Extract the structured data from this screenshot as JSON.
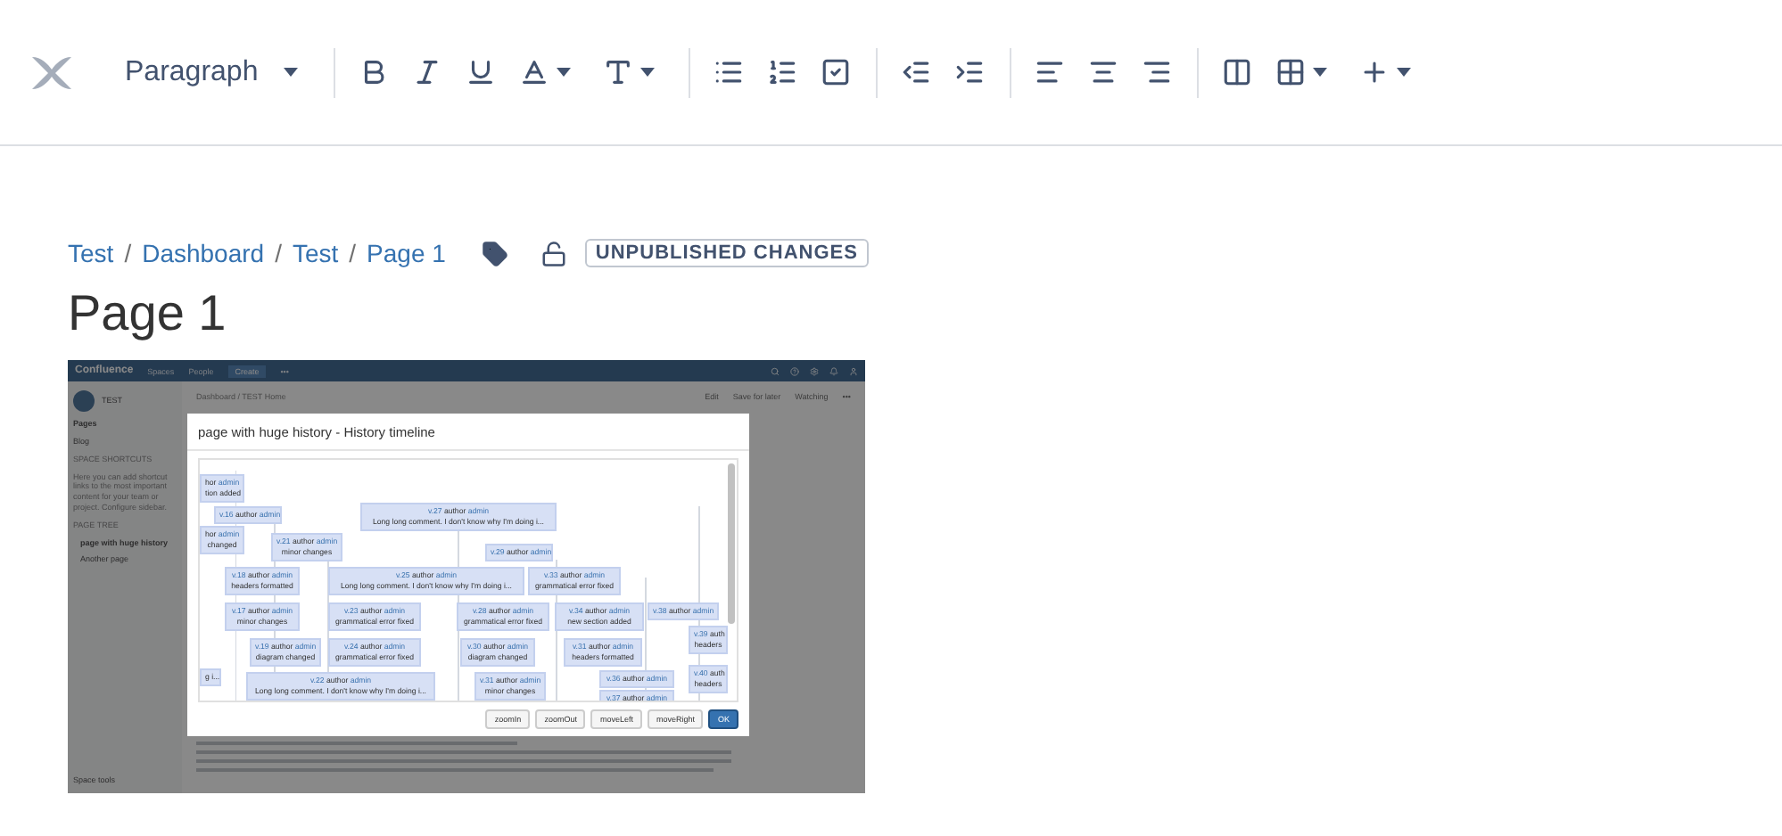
{
  "toolbar": {
    "style_menu": "Paragraph",
    "groups": [
      [
        {
          "kind": "bold",
          "menu": false
        },
        {
          "kind": "italic",
          "menu": false
        },
        {
          "kind": "underline",
          "menu": false
        },
        {
          "kind": "text-color",
          "menu": true
        },
        {
          "kind": "text-format",
          "menu": true
        }
      ],
      [
        {
          "kind": "bullet-list",
          "menu": false
        },
        {
          "kind": "number-list",
          "menu": false
        },
        {
          "kind": "task-list",
          "menu": false
        }
      ],
      [
        {
          "kind": "outdent",
          "menu": false
        },
        {
          "kind": "indent",
          "menu": false
        }
      ],
      [
        {
          "kind": "align-left",
          "menu": false
        },
        {
          "kind": "align-center",
          "menu": false
        },
        {
          "kind": "align-right",
          "menu": false
        }
      ],
      [
        {
          "kind": "layout",
          "menu": false
        },
        {
          "kind": "table",
          "menu": true
        },
        {
          "kind": "insert",
          "menu": true
        }
      ]
    ]
  },
  "breadcrumbs": {
    "separator": "/",
    "items": [
      "Test",
      "Dashboard",
      "Test",
      "Page 1"
    ]
  },
  "status_badge": "UNPUBLISHED CHANGES",
  "page_title": "Page 1",
  "embedded_screenshot": {
    "header": {
      "logo": "Confluence",
      "nav": [
        "Spaces",
        "People"
      ],
      "create": "Create",
      "more": "•••"
    },
    "sidebar": {
      "space": "TEST",
      "links": [
        "Pages",
        "Blog"
      ],
      "shortcuts_heading": "SPACE SHORTCUTS",
      "shortcuts_text": "Here you can add shortcut links to the most important content for your team or project. Configure sidebar.",
      "tree_heading": "PAGE TREE",
      "tree": [
        {
          "title": "page with huge history",
          "selected": true
        },
        {
          "title": "Another page",
          "selected": false
        }
      ],
      "footer": "Space tools"
    },
    "main": {
      "breadcrumb": "Dashboard / TEST Home",
      "actions": [
        "Edit",
        "Save for later",
        "Watching",
        "•••"
      ]
    },
    "dialog": {
      "title": "page with huge history - History timeline",
      "nodes": [
        {
          "author_label": "hor",
          "author": "admin",
          "comment": "tion added"
        },
        {
          "version": "v.16",
          "author_label": "author",
          "author": "admin"
        },
        {
          "author_label": "hor",
          "author": "admin",
          "comment": "changed"
        },
        {
          "version": "v.21",
          "author_label": "author",
          "author": "admin",
          "comment": "minor changes"
        },
        {
          "version": "v.27",
          "author_label": "author",
          "author": "admin",
          "comment": "Long long comment. I don't know why I'm doing i..."
        },
        {
          "version": "v.29",
          "author_label": "author",
          "author": "admin"
        },
        {
          "version": "v.18",
          "author_label": "author",
          "author": "admin",
          "comment": "headers formatted"
        },
        {
          "version": "v.25",
          "author_label": "author",
          "author": "admin",
          "comment": "Long long comment. I don't know why I'm doing i..."
        },
        {
          "version": "v.33",
          "author_label": "author",
          "author": "admin",
          "comment": "grammatical error fixed"
        },
        {
          "version": "v.17",
          "author_label": "author",
          "author": "admin",
          "comment": "minor changes"
        },
        {
          "version": "v.23",
          "author_label": "author",
          "author": "admin",
          "comment": "grammatical error fixed"
        },
        {
          "version": "v.28",
          "author_label": "author",
          "author": "admin",
          "comment": "grammatical error fixed"
        },
        {
          "version": "v.34",
          "author_label": "author",
          "author": "admin",
          "comment": "new section added"
        },
        {
          "version": "v.38",
          "author_label": "author",
          "author": "admin"
        },
        {
          "version": "v.19",
          "author_label": "author",
          "author": "admin",
          "comment": "diagram changed"
        },
        {
          "version": "v.24",
          "author_label": "author",
          "author": "admin",
          "comment": "grammatical error fixed"
        },
        {
          "version": "v.30",
          "author_label": "author",
          "author": "admin",
          "comment": "diagram changed"
        },
        {
          "version": "v.31",
          "author_label": "author",
          "author": "admin",
          "comment": "headers formatted"
        },
        {
          "version": "v.39",
          "author_label": "auth",
          "comment": "headers"
        },
        {
          "comment": "g i..."
        },
        {
          "version": "v.22",
          "author_label": "author",
          "author": "admin",
          "comment": "Long long comment. I don't know why I'm doing i..."
        },
        {
          "version": "v.31",
          "author_label": "author",
          "author": "admin",
          "comment": "minor changes"
        },
        {
          "version": "v.36",
          "author_label": "author",
          "author": "admin"
        },
        {
          "version": "v.40",
          "author_label": "auth",
          "comment": "headers"
        },
        {
          "version": "v.37",
          "author_label": "author",
          "author": "admin"
        }
      ],
      "buttons": [
        {
          "label": "zoomIn",
          "primary": false
        },
        {
          "label": "zoomOut",
          "primary": false
        },
        {
          "label": "moveLeft",
          "primary": false
        },
        {
          "label": "moveRight",
          "primary": false
        },
        {
          "label": "OK",
          "primary": true
        }
      ]
    }
  }
}
